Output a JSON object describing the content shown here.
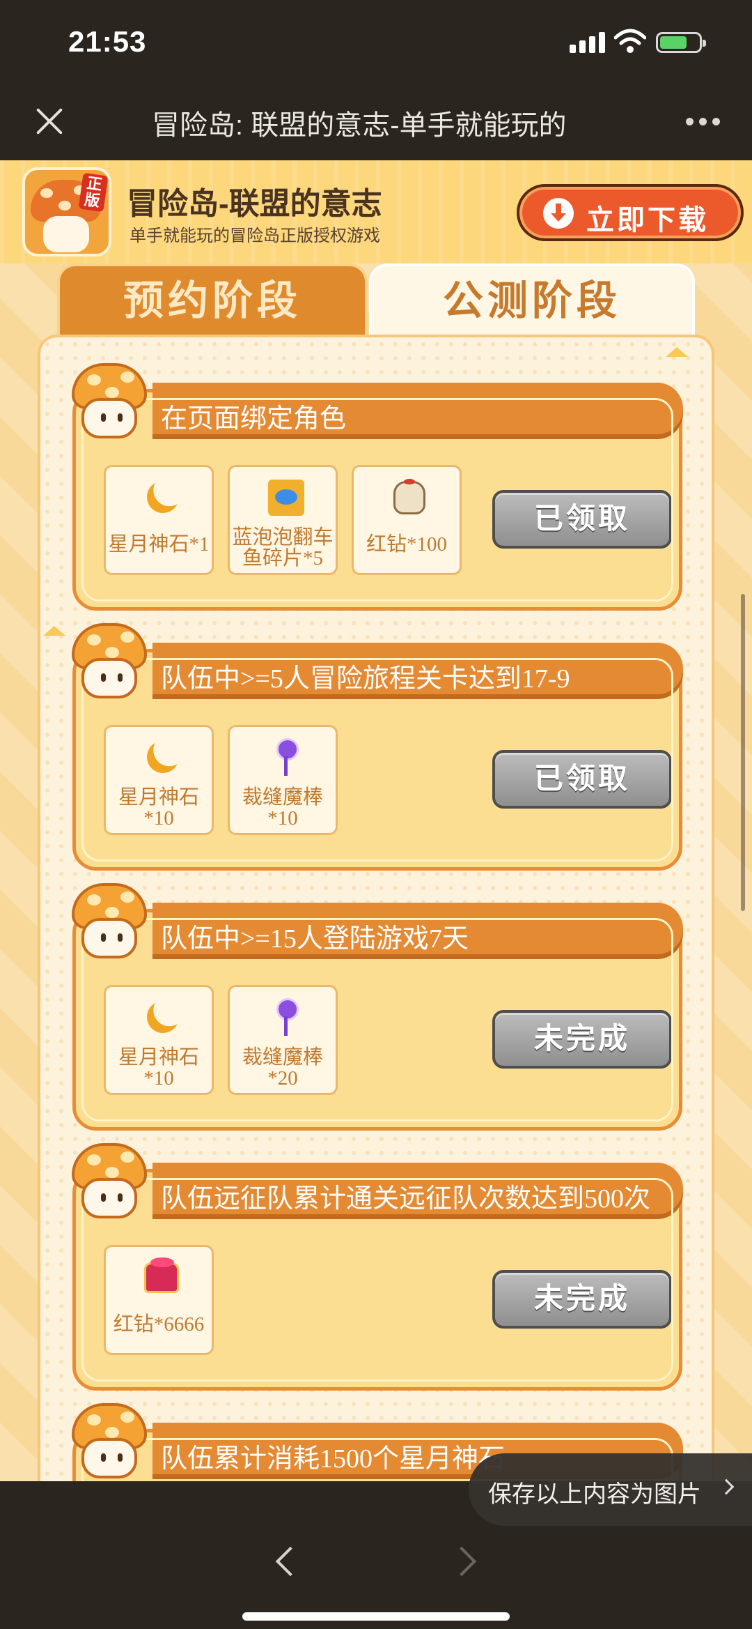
{
  "status_bar": {
    "time": "21:53"
  },
  "title_bar": {
    "title": "冒险岛: 联盟的意志-单手就能玩的"
  },
  "banner": {
    "app_name": "冒险岛-联盟的意志",
    "tagline": "单手就能玩的冒险岛正版授权游戏",
    "icon_badge": "正版",
    "download_label": "立即下载"
  },
  "tabs": [
    {
      "label": "预约阶段",
      "active": false
    },
    {
      "label": "公测阶段",
      "active": true
    }
  ],
  "tasks": [
    {
      "title": "在页面绑定角色",
      "rewards": [
        {
          "icon": "moon-stone-icon",
          "label": "星月神石*1"
        },
        {
          "icon": "fish-fragment-icon",
          "label": "蓝泡泡翻车鱼碎片*5"
        },
        {
          "icon": "red-diamond-bag-icon",
          "label": "红钻*100"
        }
      ],
      "status": "已领取"
    },
    {
      "title": "队伍中>=5人冒险旅程关卡达到17-9",
      "rewards": [
        {
          "icon": "moon-stone-icon",
          "label": "星月神石*10"
        },
        {
          "icon": "tailor-wand-icon",
          "label": "裁缝魔棒*10"
        }
      ],
      "status": "已领取"
    },
    {
      "title": "队伍中>=15人登陆游戏7天",
      "rewards": [
        {
          "icon": "moon-stone-icon",
          "label": "星月神石*10"
        },
        {
          "icon": "tailor-wand-icon",
          "label": "裁缝魔棒*20"
        }
      ],
      "status": "未完成"
    },
    {
      "title": "队伍远征队累计通关远征队次数达到500次",
      "rewards": [
        {
          "icon": "red-diamond-chest-icon",
          "label": "红钻*6666"
        }
      ],
      "status": "未完成"
    },
    {
      "title": "队伍累计消耗1500个星月神石",
      "rewards": [],
      "status": ""
    }
  ],
  "reward_lines": {
    "t0r0": "星月神石*1",
    "t0r1a": "蓝泡泡翻车",
    "t0r1b": "鱼碎片*5",
    "t0r2": "红钻*100",
    "t1r0a": "星月神石",
    "t1r0b": "*10",
    "t1r1a": "裁缝魔棒",
    "t1r1b": "*10",
    "t2r0a": "星月神石",
    "t2r0b": "*10",
    "t2r1a": "裁缝魔棒",
    "t2r1b": "*20",
    "t3r0": "红钻*6666"
  },
  "save_pill": {
    "label": "保存以上内容为图片"
  },
  "colors": {
    "accent": "#e48a33",
    "banner": "#fcd77c",
    "download": "#ec5a2c",
    "status_btn": "#9e9e9e"
  }
}
